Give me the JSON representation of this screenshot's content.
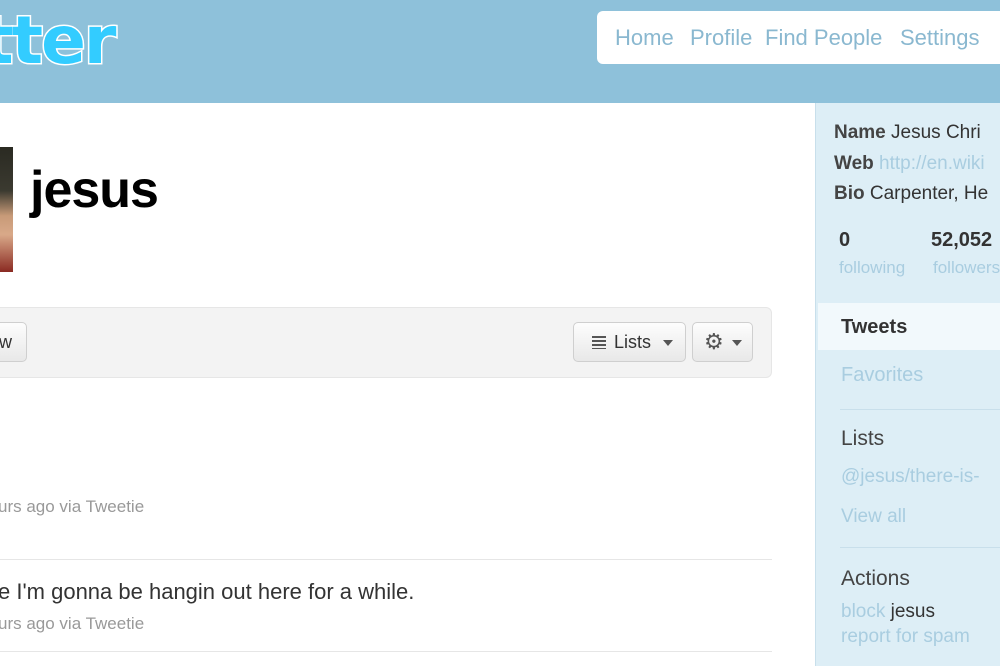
{
  "header": {
    "logo_text": "tter",
    "nav": [
      "Home",
      "Profile",
      "Find People",
      "Settings"
    ]
  },
  "profile": {
    "username": "jesus",
    "follow_label": "w",
    "lists_label": "Lists"
  },
  "tweets": [
    {
      "text": "",
      "meta": "urs ago via Tweetie"
    },
    {
      "text": "e I'm gonna be hangin out here for a while.",
      "meta": "urs ago via Tweetie"
    }
  ],
  "sidebar": {
    "name_label": "Name",
    "name_value": "Jesus Chri",
    "web_label": "Web",
    "web_value": "http://en.wiki",
    "bio_label": "Bio",
    "bio_value": "Carpenter, He",
    "following_count": "0",
    "following_label": "following",
    "followers_count": "52,052",
    "followers_label": "followers",
    "tab_tweets": "Tweets",
    "tab_favorites": "Favorites",
    "lists_heading": "Lists",
    "list_link": "@jesus/there-is-",
    "view_all": "View all",
    "actions_heading": "Actions",
    "block_link": "block",
    "block_name": "jesus",
    "report_link": "report for spam"
  },
  "colors": {
    "header_bg": "#8ec1da",
    "sidebar_bg": "#ddeef6",
    "link": "#a9cde0",
    "logo": "#33ccff"
  }
}
